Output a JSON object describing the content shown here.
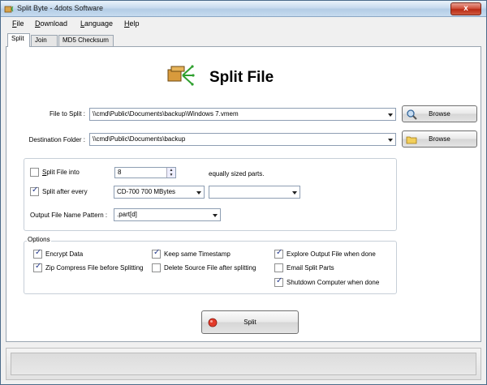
{
  "window": {
    "title": "Split Byte - 4dots Software",
    "close_label": "x"
  },
  "menu": [
    {
      "key": "F",
      "rest": "ile"
    },
    {
      "key": "D",
      "rest": "ownload"
    },
    {
      "key": "L",
      "rest": "anguage"
    },
    {
      "key": "H",
      "rest": "elp"
    }
  ],
  "tabs": [
    {
      "label": "Split"
    },
    {
      "label": "Join"
    },
    {
      "label": "MD5 Checksum"
    }
  ],
  "header": {
    "title": "Split File"
  },
  "file_to_split": {
    "label": "File to Split :",
    "value": "\\\\cmd\\Public\\Documents\\backup\\Windows 7.vmem",
    "browse_label": "Browse"
  },
  "destination": {
    "label": "Destination Folder :",
    "value": "\\\\cmd\\Public\\Documents\\backup",
    "browse_label": "Browse"
  },
  "split_options": {
    "split_into_label": "Split File into",
    "split_into_checked": false,
    "parts_value": "8",
    "parts_suffix": "equally sized parts.",
    "split_every_label": "Split after every",
    "split_every_checked": true,
    "size_preset": "CD-700 700 MBytes",
    "size_unit": "",
    "pattern_label": "Output File Name Pattern :",
    "pattern_value": ".part[d]"
  },
  "options": {
    "title": "Options",
    "items": [
      {
        "label": "Encrypt Data",
        "checked": true
      },
      {
        "label": "Zip Compress File before Splitting",
        "checked": true
      },
      {
        "label": "Keep same Timestamp",
        "checked": true
      },
      {
        "label": "Delete Source File after splitting",
        "checked": false
      },
      {
        "label": "Explore Output File when done",
        "checked": true
      },
      {
        "label": "Email Split Parts",
        "checked": false
      },
      {
        "label": "Shutdown Computer when done",
        "checked": true
      }
    ]
  },
  "split_button": {
    "label": "Split"
  },
  "colors": {
    "accent": "#2a3f8f",
    "title_bar": "#c8dbee",
    "close": "#c8402a"
  }
}
